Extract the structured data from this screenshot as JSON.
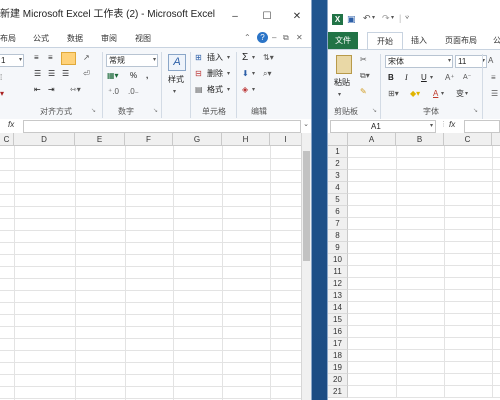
{
  "left_window": {
    "title": "新建 Microsoft Excel 工作表 (2) - Microsoft Excel",
    "caption": {
      "minimize": "–",
      "maximize": "☐",
      "close": "✕"
    },
    "tabs": [
      "布局",
      "公式",
      "数据",
      "审阅",
      "视图"
    ],
    "ribbon": {
      "font_size": "1",
      "number_format": "常规",
      "percent": "%",
      "comma": ",",
      "styles_label": "样式",
      "insert_label": "插入",
      "delete_label": "删除",
      "format_label": "格式",
      "sum_symbol": "Σ",
      "groups": [
        "对齐方式",
        "数字",
        "单元格",
        "编辑"
      ]
    },
    "formula_bar": {
      "fx": "fx"
    },
    "columns": [
      "C",
      "D",
      "E",
      "F",
      "G",
      "H",
      "I"
    ]
  },
  "right_window": {
    "quick_access": {
      "undo": "↶",
      "redo": "↷"
    },
    "tabs": [
      "文件",
      "开始",
      "插入",
      "页面布局",
      "公"
    ],
    "ribbon": {
      "paste_label": "粘贴",
      "font_name": "宋体",
      "font_size": "11",
      "bold": "B",
      "italic": "I",
      "underline": "U",
      "font_color_letter": "A",
      "phonetic": "变",
      "groups": [
        "剪贴板",
        "字体"
      ]
    },
    "name_box": "A1",
    "formula_bar": {
      "fx": "fx"
    },
    "columns": [
      "A",
      "B",
      "C"
    ],
    "rows": [
      "1",
      "2",
      "3",
      "4",
      "5",
      "6",
      "7",
      "8",
      "9",
      "10",
      "11",
      "12",
      "13",
      "14",
      "15",
      "16",
      "17",
      "18",
      "19",
      "20",
      "21"
    ]
  },
  "colors": {
    "accent_green": "#217346",
    "help_blue": "#2b74c7"
  }
}
